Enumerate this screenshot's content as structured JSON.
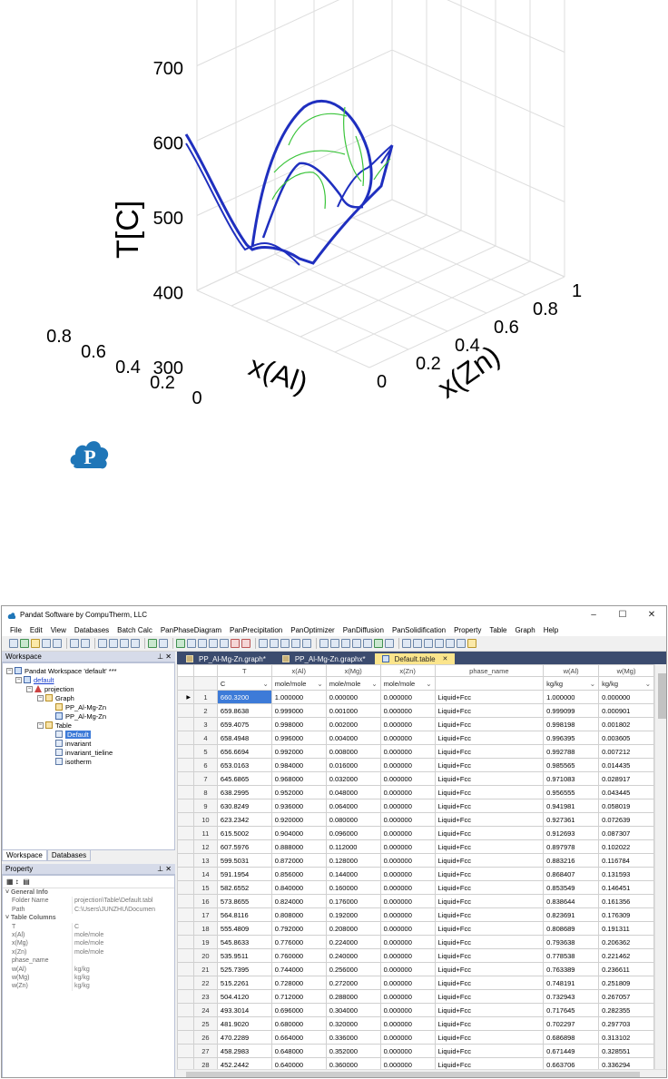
{
  "chart_data": {
    "type": "line",
    "subtype": "3d-projection",
    "zlabel": "T[C]",
    "xlabel": "x(Al)",
    "ylabel": "x(Zn)",
    "z_ticks": [
      "700",
      "600",
      "500",
      "400",
      "300"
    ],
    "x_ticks": [
      "0",
      "0.2",
      "0.4",
      "0.6",
      "0.8"
    ],
    "y_ticks": [
      "0",
      "0.2",
      "0.4",
      "0.6",
      "0.8",
      "1"
    ],
    "zlim": [
      300,
      700
    ],
    "xlim": [
      0,
      1
    ],
    "ylim": [
      0,
      1
    ],
    "grid": true,
    "series": [
      {
        "color": "#1f2fbf"
      },
      {
        "color": "#3ac43a"
      }
    ]
  },
  "window": {
    "title": "Pandat Software by CompuTherm, LLC",
    "controls": [
      "–",
      "☐",
      "✕"
    ]
  },
  "menu": [
    "File",
    "Edit",
    "View",
    "Databases",
    "Batch Calc",
    "PanPhaseDiagram",
    "PanPrecipitation",
    "PanOptimizer",
    "PanDiffusion",
    "PanSolidification",
    "Property",
    "Table",
    "Graph",
    "Help"
  ],
  "workspace": {
    "panel_title": "Workspace",
    "root": "Pandat Workspace 'default' ***",
    "default_node": "default",
    "projection": "projection",
    "graph": "Graph",
    "graph_items": [
      "PP_Al-Mg-Zn",
      "PP_Al-Mg-Zn"
    ],
    "table": "Table",
    "table_items": [
      "Default",
      "invariant",
      "invariant_tieline",
      "isotherm"
    ],
    "bottom_tabs": [
      "Workspace",
      "Databases"
    ]
  },
  "property": {
    "panel_title": "Property",
    "general_info": "General Info",
    "rows": [
      {
        "k": "Folder Name",
        "v": "projection\\Table\\Default.tabl"
      },
      {
        "k": "Path",
        "v": "C:\\Users\\JUNZHU\\Documen"
      }
    ],
    "table_columns": "Table Columns",
    "cols": [
      {
        "k": "T",
        "v": "C"
      },
      {
        "k": "x(Al)",
        "v": "mole/mole"
      },
      {
        "k": "x(Mg)",
        "v": "mole/mole"
      },
      {
        "k": "x(Zn)",
        "v": "mole/mole"
      },
      {
        "k": "phase_name",
        "v": ""
      },
      {
        "k": "w(Al)",
        "v": "kg/kg"
      },
      {
        "k": "w(Mg)",
        "v": "kg/kg"
      },
      {
        "k": "w(Zn)",
        "v": "kg/kg"
      }
    ]
  },
  "doc_tabs": [
    {
      "label": "PP_Al-Mg-Zn.graph*"
    },
    {
      "label": "PP_Al-Mg-Zn.graphx*"
    },
    {
      "label": "Default.table"
    }
  ],
  "table": {
    "headers": [
      "T",
      "x(Al)",
      "x(Mg)",
      "x(Zn)",
      "phase_name",
      "w(Al)",
      "w(Mg)"
    ],
    "units": [
      "C",
      "mole/mole",
      "mole/mole",
      "mole/mole",
      "",
      "kg/kg",
      "kg/kg"
    ],
    "rows": [
      [
        "1",
        "660.3200",
        "1.000000",
        "0.000000",
        "0.000000",
        "Liquid+Fcc",
        "1.000000",
        "0.000000"
      ],
      [
        "2",
        "659.8638",
        "0.999000",
        "0.001000",
        "0.000000",
        "Liquid+Fcc",
        "0.999099",
        "0.000901"
      ],
      [
        "3",
        "659.4075",
        "0.998000",
        "0.002000",
        "0.000000",
        "Liquid+Fcc",
        "0.998198",
        "0.001802"
      ],
      [
        "4",
        "658.4948",
        "0.996000",
        "0.004000",
        "0.000000",
        "Liquid+Fcc",
        "0.996395",
        "0.003605"
      ],
      [
        "5",
        "656.6694",
        "0.992000",
        "0.008000",
        "0.000000",
        "Liquid+Fcc",
        "0.992788",
        "0.007212"
      ],
      [
        "6",
        "653.0163",
        "0.984000",
        "0.016000",
        "0.000000",
        "Liquid+Fcc",
        "0.985565",
        "0.014435"
      ],
      [
        "7",
        "645.6865",
        "0.968000",
        "0.032000",
        "0.000000",
        "Liquid+Fcc",
        "0.971083",
        "0.028917"
      ],
      [
        "8",
        "638.2995",
        "0.952000",
        "0.048000",
        "0.000000",
        "Liquid+Fcc",
        "0.956555",
        "0.043445"
      ],
      [
        "9",
        "630.8249",
        "0.936000",
        "0.064000",
        "0.000000",
        "Liquid+Fcc",
        "0.941981",
        "0.058019"
      ],
      [
        "10",
        "623.2342",
        "0.920000",
        "0.080000",
        "0.000000",
        "Liquid+Fcc",
        "0.927361",
        "0.072639"
      ],
      [
        "11",
        "615.5002",
        "0.904000",
        "0.096000",
        "0.000000",
        "Liquid+Fcc",
        "0.912693",
        "0.087307"
      ],
      [
        "12",
        "607.5976",
        "0.888000",
        "0.112000",
        "0.000000",
        "Liquid+Fcc",
        "0.897978",
        "0.102022"
      ],
      [
        "13",
        "599.5031",
        "0.872000",
        "0.128000",
        "0.000000",
        "Liquid+Fcc",
        "0.883216",
        "0.116784"
      ],
      [
        "14",
        "591.1954",
        "0.856000",
        "0.144000",
        "0.000000",
        "Liquid+Fcc",
        "0.868407",
        "0.131593"
      ],
      [
        "15",
        "582.6552",
        "0.840000",
        "0.160000",
        "0.000000",
        "Liquid+Fcc",
        "0.853549",
        "0.146451"
      ],
      [
        "16",
        "573.8655",
        "0.824000",
        "0.176000",
        "0.000000",
        "Liquid+Fcc",
        "0.838644",
        "0.161356"
      ],
      [
        "17",
        "564.8116",
        "0.808000",
        "0.192000",
        "0.000000",
        "Liquid+Fcc",
        "0.823691",
        "0.176309"
      ],
      [
        "18",
        "555.4809",
        "0.792000",
        "0.208000",
        "0.000000",
        "Liquid+Fcc",
        "0.808689",
        "0.191311"
      ],
      [
        "19",
        "545.8633",
        "0.776000",
        "0.224000",
        "0.000000",
        "Liquid+Fcc",
        "0.793638",
        "0.206362"
      ],
      [
        "20",
        "535.9511",
        "0.760000",
        "0.240000",
        "0.000000",
        "Liquid+Fcc",
        "0.778538",
        "0.221462"
      ],
      [
        "21",
        "525.7395",
        "0.744000",
        "0.256000",
        "0.000000",
        "Liquid+Fcc",
        "0.763389",
        "0.236611"
      ],
      [
        "22",
        "515.2261",
        "0.728000",
        "0.272000",
        "0.000000",
        "Liquid+Fcc",
        "0.748191",
        "0.251809"
      ],
      [
        "23",
        "504.4120",
        "0.712000",
        "0.288000",
        "0.000000",
        "Liquid+Fcc",
        "0.732943",
        "0.267057"
      ],
      [
        "24",
        "493.3014",
        "0.696000",
        "0.304000",
        "0.000000",
        "Liquid+Fcc",
        "0.717645",
        "0.282355"
      ],
      [
        "25",
        "481.9020",
        "0.680000",
        "0.320000",
        "0.000000",
        "Liquid+Fcc",
        "0.702297",
        "0.297703"
      ],
      [
        "26",
        "470.2289",
        "0.664000",
        "0.336000",
        "0.000000",
        "Liquid+Fcc",
        "0.686898",
        "0.313102"
      ],
      [
        "27",
        "458.2983",
        "0.648000",
        "0.352000",
        "0.000000",
        "Liquid+Fcc",
        "0.671449",
        "0.328551"
      ],
      [
        "28",
        "452.2442",
        "0.640000",
        "0.360000",
        "0.000000",
        "Liquid+Fcc",
        "0.663706",
        "0.336294"
      ],
      [
        "29",
        "450.7220",
        "0.638000",
        "0.362000",
        "0.000000",
        "Liquid+Fcc",
        "0.661768",
        "0.338232"
      ],
      [
        "30",
        "450.5315",
        "0.637750",
        "0.362250",
        "0.000000",
        "Liquid+Fcc",
        "0.661525",
        "0.338475"
      ],
      [
        "31",
        "450.4839",
        "0.637688",
        "0.362313",
        "0.000000",
        "Liquid+Fcc",
        "0.661465",
        "0.338535"
      ]
    ]
  }
}
